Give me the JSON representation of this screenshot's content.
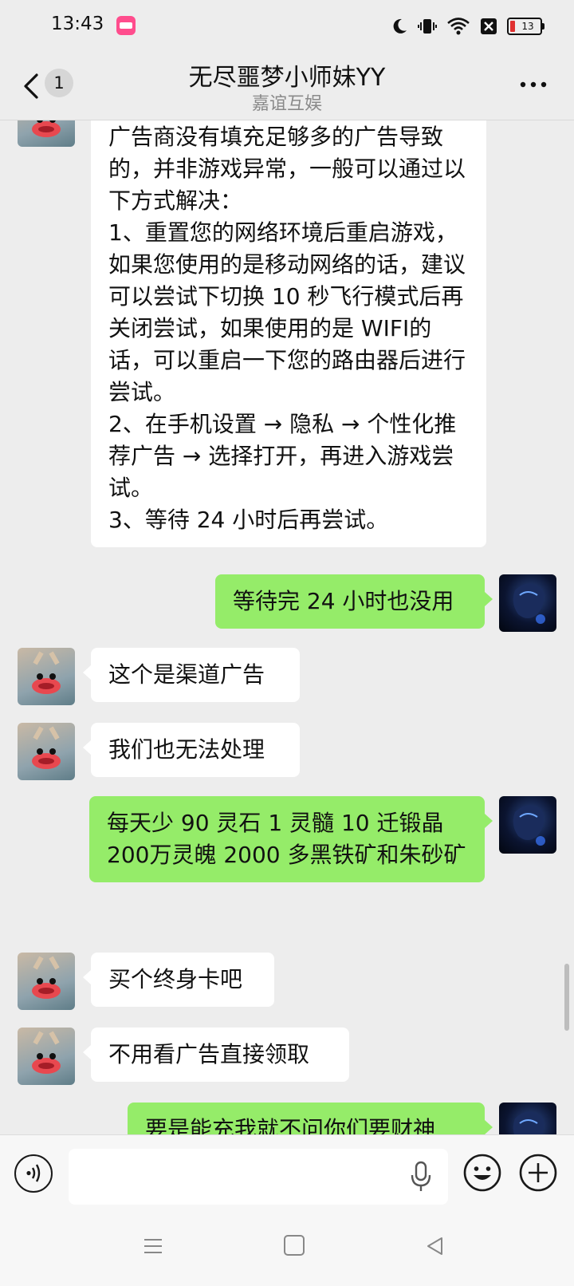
{
  "status_bar": {
    "time": "13:43",
    "battery": "13",
    "icons": [
      "app-notification-icon",
      "moon-icon",
      "vibrate-icon",
      "wifi-icon",
      "x-box-icon",
      "battery-icon"
    ]
  },
  "header": {
    "unread_count": "1",
    "title": "无尽噩梦小师妹YY",
    "subtitle": "嘉谊互娱"
  },
  "messages": [
    {
      "from": "other",
      "text": "亲爱的玩家您好，该提示一般是由于广告商没有填充足够多的广告导致的，并非游戏异常，一般可以通过以下方式解决：\n1、重置您的网络环境后重启游戏，如果您使用的是移动网络的话，建议可以尝试下切换 10 秒飞行模式后再关闭尝试，如果使用的是 WIFI的话，可以重启一下您的路由器后进行尝试。\n2、在手机设置 → 隐私 → 个性化推荐广告 → 选择打开，再进入游戏尝试。\n3、等待 24 小时后再尝试。"
    },
    {
      "from": "me",
      "text": "等待完 24 小时也没用"
    },
    {
      "from": "other",
      "text": "这个是渠道广告"
    },
    {
      "from": "other",
      "text": "我们也无法处理"
    },
    {
      "from": "me",
      "text": "每天少 90 灵石 1 灵髓 10 迁锻晶 200万灵魄 2000 多黑铁矿和朱砂矿"
    },
    {
      "from": "other",
      "text": "买个终身卡吧"
    },
    {
      "from": "other",
      "text": "不用看广告直接领取"
    },
    {
      "from": "me",
      "text": "要是能充我就不问你们要财神"
    }
  ],
  "input": {
    "value": "",
    "placeholder": ""
  },
  "colors": {
    "background": "#ededed",
    "outgoing_bubble": "#95ec69",
    "incoming_bubble": "#ffffff"
  }
}
